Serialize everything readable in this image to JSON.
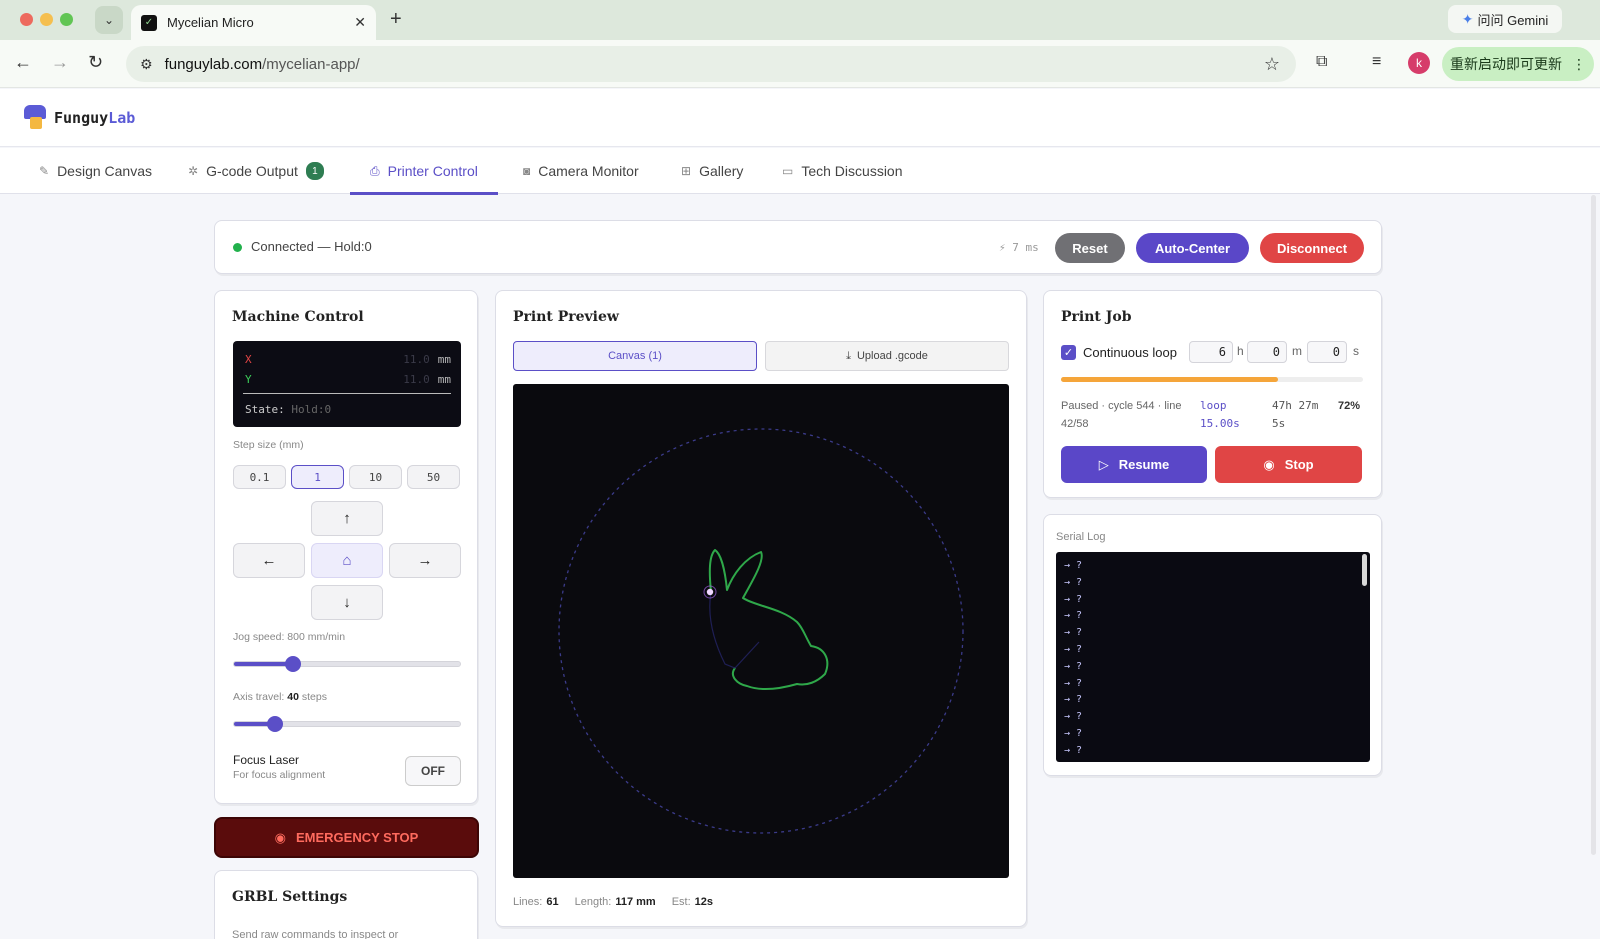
{
  "browser": {
    "tab_title": "Mycelian Micro",
    "tab_close": "✕",
    "new_tab": "+",
    "url_host": "funguylab.com",
    "url_path": "/mycelian-app/",
    "gemini_label": "问问 Gemini",
    "avatar_letter": "k",
    "update_label": "重新启动即可更新",
    "update_menu": "⋮"
  },
  "app": {
    "logo_text_a": "Funguy",
    "logo_text_b": "Lab",
    "nav": [
      {
        "label": "Design Canvas",
        "icon": "pencil-icon"
      },
      {
        "label": "G-code Output",
        "icon": "gear-icon",
        "badge": "1"
      },
      {
        "label": "Printer Control",
        "icon": "printer-icon",
        "active": true
      },
      {
        "label": "Camera Monitor",
        "icon": "camera-icon"
      },
      {
        "label": "Gallery",
        "icon": "grid-icon"
      },
      {
        "label": "Tech Discussion",
        "icon": "chat-icon"
      }
    ]
  },
  "status": {
    "text": "Connected — Hold:0",
    "latency": "⚡ 7 ms",
    "reset_label": "Reset",
    "autocenter_label": "Auto-Center",
    "disconnect_label": "Disconnect",
    "connected_color": "#22b14c"
  },
  "machine_control": {
    "title": "Machine Control",
    "dro": {
      "x_label": "X",
      "x_value": "11.0",
      "x_unit": "mm",
      "y_label": "Y",
      "y_value": "11.0",
      "y_unit": "mm",
      "state_label": "State:",
      "state_value": "Hold:0"
    },
    "step_label": "Step size (mm)",
    "steps": [
      "0.1",
      "1",
      "10",
      "50"
    ],
    "active_step": "1",
    "jog_speed_label": "Jog speed: 800 mm/min",
    "jog_speed_value": 800,
    "jog_speed_fraction": 0.26,
    "axis_travel_label": "Axis travel:",
    "axis_travel_value": "40",
    "axis_travel_unit": "steps",
    "axis_travel_fraction": 0.18,
    "focus_label": "Focus Laser",
    "focus_sub": "For focus alignment",
    "focus_state": "OFF"
  },
  "emergency": {
    "label": "EMERGENCY STOP"
  },
  "grbl": {
    "title": "GRBL Settings",
    "sub": "Send raw commands to inspect or"
  },
  "preview": {
    "title": "Print Preview",
    "tab_canvas": "Canvas (1)",
    "tab_upload": "Upload .gcode",
    "stats": {
      "lines_label": "Lines:",
      "lines_value": "61",
      "length_label": "Length:",
      "length_value": "117 mm",
      "est_label": "Est:",
      "est_value": "12s"
    }
  },
  "print_job": {
    "title": "Print Job",
    "loop_label": "Continuous loop",
    "loop_checked": true,
    "hours": "6",
    "hours_unit": "h",
    "minutes": "0",
    "minutes_unit": "m",
    "seconds": "0",
    "seconds_unit": "s",
    "progress_fraction": 0.72,
    "progress_color": "#f5a53a",
    "state_line1": "Paused · cycle 544 · line",
    "state_line2": "42/58",
    "loop_line1": "loop",
    "loop_line2": "15.00s",
    "eta_line1": "47h 27m",
    "eta_line2": "5s",
    "percent": "72%",
    "resume_label": "Resume",
    "stop_label": "Stop"
  },
  "serial_log": {
    "title": "Serial Log",
    "lines": [
      "→ ?",
      "→ ?",
      "→ ?",
      "→ ?",
      "→ ?",
      "→ ?",
      "→ ?",
      "→ ?",
      "→ ?",
      "→ ?",
      "→ ?",
      "→ ?"
    ]
  }
}
